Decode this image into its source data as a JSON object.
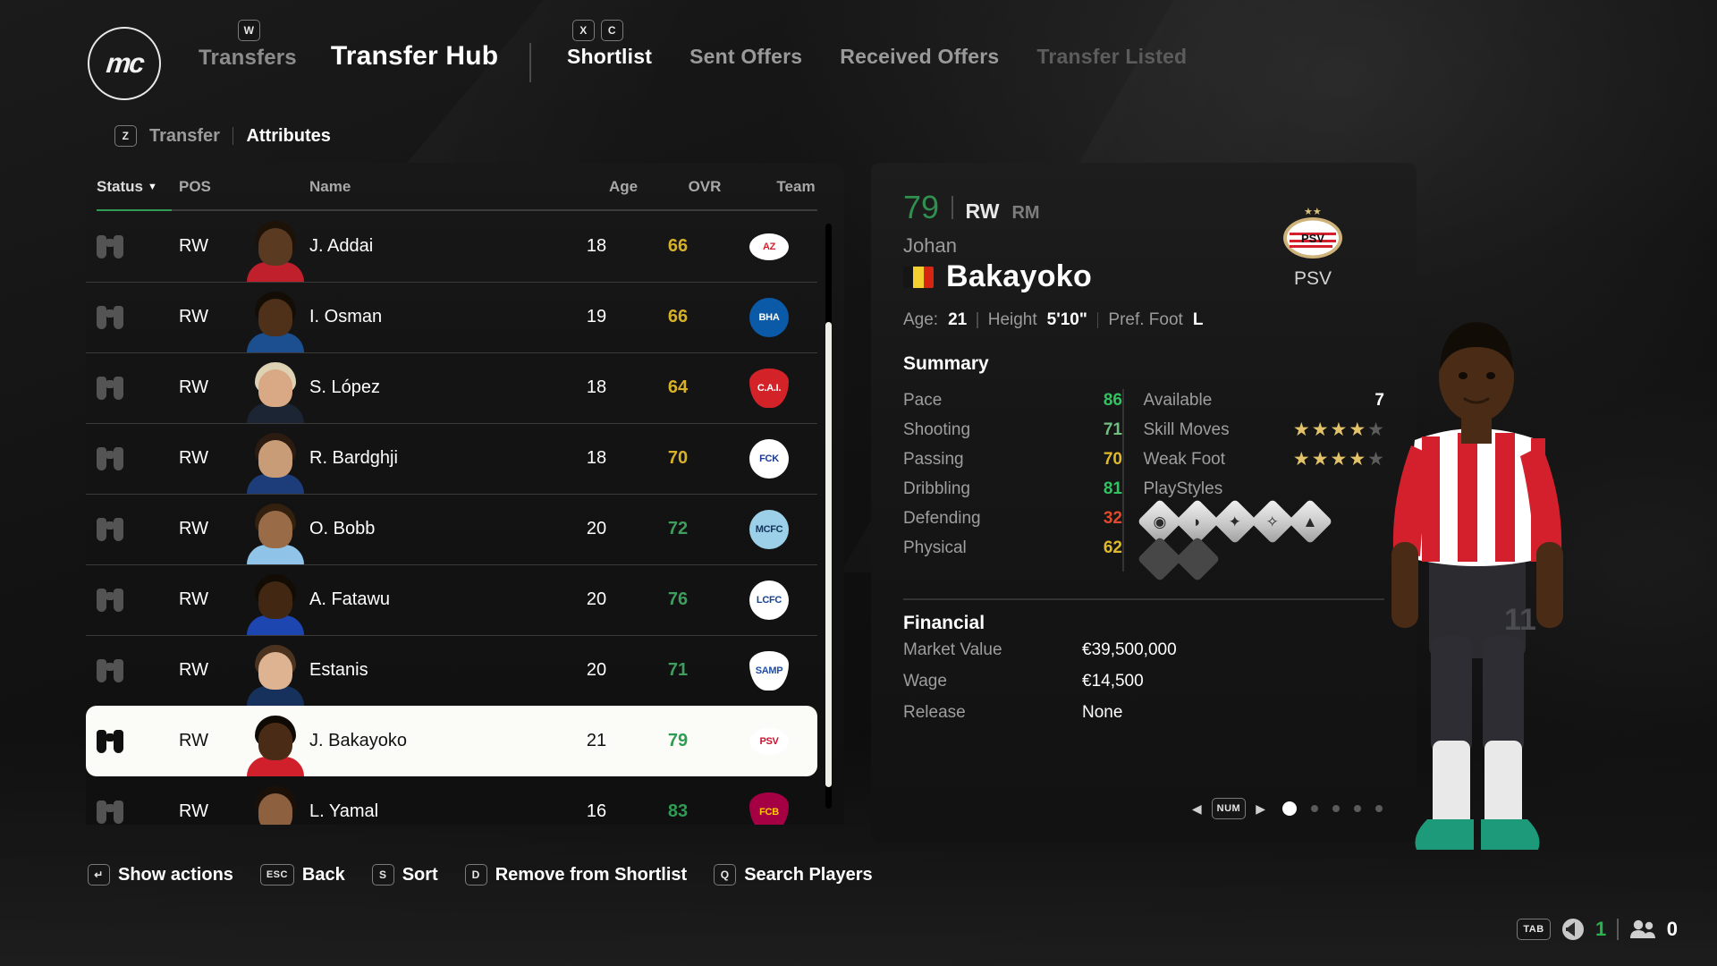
{
  "brand": {
    "logo_text": "mc",
    "logo_name": "mc-circle-logo"
  },
  "header": {
    "key_w": "W",
    "breadcrumb_parent": "Transfers",
    "title": "Transfer Hub",
    "key_x": "X",
    "key_c": "C",
    "tabs": [
      {
        "label": "Shortlist",
        "state": "active"
      },
      {
        "label": "Sent Offers",
        "state": "normal"
      },
      {
        "label": "Received Offers",
        "state": "normal"
      },
      {
        "label": "Transfer Listed",
        "state": "dim"
      }
    ]
  },
  "subtabs": {
    "key_z": "Z",
    "items": [
      {
        "label": "Transfer",
        "state": "normal"
      },
      {
        "label": "Attributes",
        "state": "active"
      }
    ]
  },
  "list": {
    "columns": {
      "status": "Status",
      "sort_caret": "▼",
      "pos": "POS",
      "name": "Name",
      "age": "Age",
      "ovr": "OVR",
      "team": "Team"
    },
    "rows": [
      {
        "status_icon": "binoculars-icon",
        "pos": "RW",
        "name": "J. Addai",
        "age": "18",
        "ovr": "66",
        "ovr_color": "#d7b228",
        "team": "AZ Alkmaar",
        "selected": false,
        "face": {
          "hair": "#1d1208",
          "skin": "#5b3a22",
          "body": "#c0202c"
        },
        "badge": {
          "shape": "oval",
          "bg": "#ffffff",
          "fg": "#d2212c",
          "text": "AZ"
        }
      },
      {
        "status_icon": "binoculars-icon",
        "pos": "RW",
        "name": "I. Osman",
        "age": "19",
        "ovr": "66",
        "ovr_color": "#d7b228",
        "team": "Brighton & Hove Albion",
        "selected": false,
        "face": {
          "hair": "#140d06",
          "skin": "#4e3118",
          "body": "#1b4f8f"
        },
        "badge": {
          "shape": "circle",
          "bg": "#0b5aa8",
          "fg": "#ffffff",
          "text": "BHA"
        }
      },
      {
        "status_icon": "binoculars-icon",
        "pos": "RW",
        "name": "S. López",
        "age": "18",
        "ovr": "64",
        "ovr_color": "#d7b228",
        "team": "Independiente",
        "selected": false,
        "face": {
          "hair": "#ddd2b4",
          "skin": "#d9a985",
          "body": "#1b2533"
        },
        "badge": {
          "shape": "shield",
          "bg": "#d42229",
          "fg": "#ffffff",
          "text": "C.A.I."
        }
      },
      {
        "status_icon": "binoculars-icon",
        "pos": "RW",
        "name": "R. Bardghji",
        "age": "18",
        "ovr": "70",
        "ovr_color": "#d7b228",
        "team": "FC København",
        "selected": false,
        "face": {
          "hair": "#2b1b10",
          "skin": "#c99c78",
          "body": "#1d3d7a"
        },
        "badge": {
          "shape": "circle",
          "bg": "#ffffff",
          "fg": "#1b3a8f",
          "text": "FCK"
        }
      },
      {
        "status_icon": "binoculars-icon",
        "pos": "RW",
        "name": "O. Bobb",
        "age": "20",
        "ovr": "72",
        "ovr_color": "#3f9e5e",
        "team": "Manchester City",
        "selected": false,
        "face": {
          "hair": "#33200f",
          "skin": "#9a6b47",
          "body": "#8fc4e8"
        },
        "badge": {
          "shape": "circle",
          "bg": "#9bd0e8",
          "fg": "#12345a",
          "text": "MCFC"
        }
      },
      {
        "status_icon": "binoculars-icon",
        "pos": "RW",
        "name": "A. Fatawu",
        "age": "20",
        "ovr": "76",
        "ovr_color": "#3f9e5e",
        "team": "Leicester City",
        "selected": false,
        "face": {
          "hair": "#120c05",
          "skin": "#422812",
          "body": "#1e46b0"
        },
        "badge": {
          "shape": "circle",
          "bg": "#ffffff",
          "fg": "#14438f",
          "text": "LCFC"
        }
      },
      {
        "status_icon": "binoculars-icon",
        "pos": "RW",
        "name": "Estanis",
        "age": "20",
        "ovr": "71",
        "ovr_color": "#3f9e5e",
        "team": "Sampdoria",
        "selected": false,
        "face": {
          "hair": "#4b3320",
          "skin": "#ddb391",
          "body": "#16325c"
        },
        "badge": {
          "shape": "shield",
          "bg": "#ffffff",
          "fg": "#1f4fa0",
          "text": "SAMP"
        }
      },
      {
        "status_icon": "binoculars-icon",
        "pos": "RW",
        "name": "J. Bakayoko",
        "age": "21",
        "ovr": "79",
        "ovr_color": "#2e9c54",
        "team": "PSV",
        "selected": true,
        "face": {
          "hair": "#100a04",
          "skin": "#4a2c16",
          "body": "#d0202c"
        },
        "badge": {
          "shape": "oval",
          "bg": "#ffffff",
          "fg": "#c8102e",
          "text": "PSV"
        }
      },
      {
        "status_icon": "binoculars-icon",
        "pos": "RW",
        "name": "L. Yamal",
        "age": "16",
        "ovr": "83",
        "ovr_color": "#2e9c54",
        "team": "FC Barcelona",
        "selected": false,
        "face": {
          "hair": "#1a1008",
          "skin": "#8d6040",
          "body": "#8b1538"
        },
        "badge": {
          "shape": "shield",
          "bg": "#a50044",
          "fg": "#ffcb05",
          "text": "FCB"
        }
      }
    ]
  },
  "actions": [
    {
      "key": "↵",
      "label": "Show actions",
      "wide": false
    },
    {
      "key": "ESC",
      "label": "Back",
      "wide": true
    },
    {
      "key": "S",
      "label": "Sort",
      "wide": false
    },
    {
      "key": "D",
      "label": "Remove from Shortlist",
      "wide": false
    },
    {
      "key": "Q",
      "label": "Search Players",
      "wide": false
    }
  ],
  "detail": {
    "overall": "79",
    "position_main": "RW",
    "position_alt": "RM",
    "first_name": "Johan",
    "last_name": "Bakayoko",
    "nationality_flag": "Belgium",
    "flag_colors": [
      "#151515",
      "#f3d02f",
      "#d62612"
    ],
    "bio": {
      "age_label": "Age:",
      "age_value": "21",
      "height_label": "Height",
      "height_value": "5'10\"",
      "foot_label": "Pref. Foot",
      "foot_value": "L"
    },
    "club": {
      "name": "PSV",
      "badge_name": "psv-badge"
    },
    "summary": {
      "title": "Summary",
      "stats": [
        {
          "label": "Pace",
          "value": "86",
          "color": "#2fc45f"
        },
        {
          "label": "Shooting",
          "value": "71",
          "color": "#6fbf7f"
        },
        {
          "label": "Passing",
          "value": "70",
          "color": "#e0b92a"
        },
        {
          "label": "Dribbling",
          "value": "81",
          "color": "#2fc45f"
        },
        {
          "label": "Defending",
          "value": "32",
          "color": "#e04a2a"
        },
        {
          "label": "Physical",
          "value": "62",
          "color": "#e0b92a"
        }
      ],
      "available_label": "Available",
      "available_value": "7",
      "skill_moves_label": "Skill Moves",
      "skill_moves": 4,
      "skill_moves_max": 5,
      "weak_foot_label": "Weak Foot",
      "weak_foot": 4,
      "weak_foot_max": 5,
      "playstyles_label": "PlayStyles",
      "playstyles": [
        {
          "name": "quick-step-icon",
          "glyph": "◉",
          "filled": true
        },
        {
          "name": "flair-icon",
          "glyph": "◗",
          "filled": true
        },
        {
          "name": "technical-icon",
          "glyph": "✦",
          "filled": true
        },
        {
          "name": "trickster-icon",
          "glyph": "✧",
          "filled": true
        },
        {
          "name": "rapid-icon",
          "glyph": "▲",
          "filled": true
        },
        {
          "name": "empty-playstyle-slot",
          "glyph": "",
          "filled": false
        },
        {
          "name": "empty-playstyle-slot",
          "glyph": "",
          "filled": false
        }
      ]
    },
    "financial": {
      "title": "Financial",
      "rows": [
        {
          "label": "Market Value",
          "value": "€39,500,000"
        },
        {
          "label": "Wage",
          "value": "€14,500"
        },
        {
          "label": "Release",
          "value": "None"
        }
      ]
    },
    "pager": {
      "left_arrow": "◀",
      "key": "NUM",
      "right_arrow": "▶",
      "total": 5,
      "active": 1
    }
  },
  "status_bar": {
    "key_tab": "TAB",
    "speaker_icon": "speaker-icon",
    "speaker_value": "1",
    "people_icon": "people-icon",
    "people_value": "0"
  },
  "colors": {
    "accent_green": "#2e9c54",
    "accent_yellow": "#d7b228",
    "selected_row_bg": "#fbfbf8"
  }
}
